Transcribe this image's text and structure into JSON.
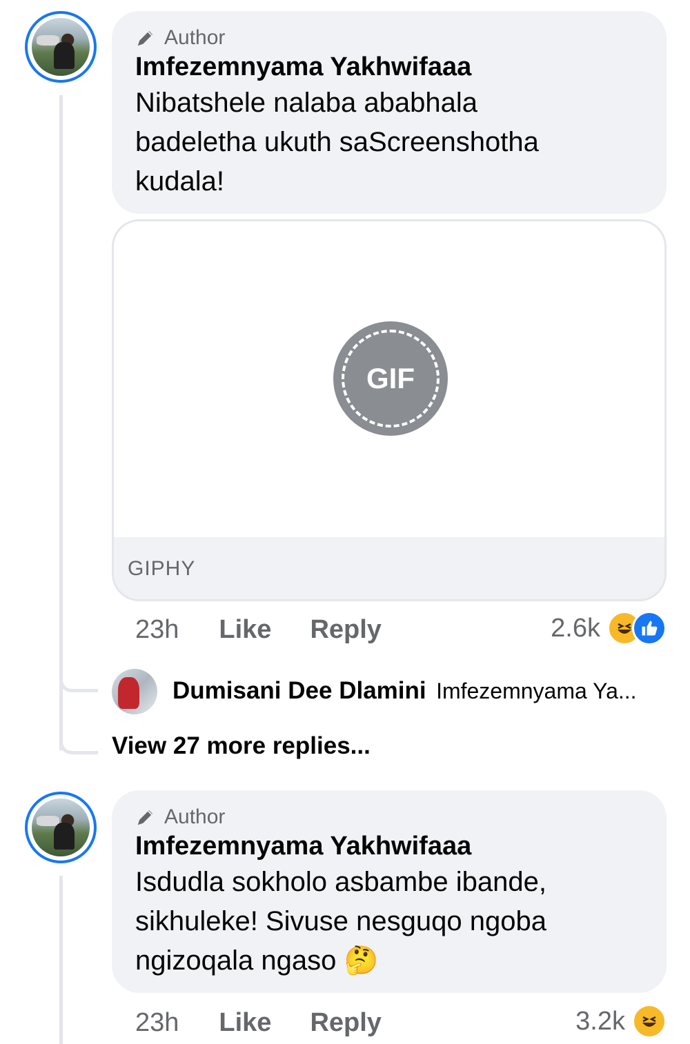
{
  "comments": [
    {
      "badge": "Author",
      "name": "Imfezemnyama Yakhwifaaa",
      "text_lines": [
        "Nibatshele nalaba ababhala",
        "badeletha ukuth saScreenshotha",
        "kudala!"
      ],
      "gif": {
        "label": "GIF",
        "provider": "GIPHY"
      },
      "time": "23h",
      "like_label": "Like",
      "reply_label": "Reply",
      "reaction_count": "2.6k",
      "reactions": [
        "haha-icon",
        "like-icon"
      ]
    },
    {
      "badge": "Author",
      "name": "Imfezemnyama Yakhwifaaa",
      "text_lines": [
        "Isdudla sokholo asbambe ibande,",
        "sikhuleke! Sivuse nesguqo ngoba",
        "ngizoqala ngaso"
      ],
      "emoji": "🤔",
      "time": "23h",
      "like_label": "Like",
      "reply_label": "Reply",
      "reaction_count": "3.2k",
      "reactions": [
        "haha-icon"
      ]
    }
  ],
  "reply_preview": {
    "name": "Dumisani Dee Dlamini",
    "snippet": "Imfezemnyama Ya..."
  },
  "view_more": "View 27 more replies...",
  "colors": {
    "accent": "#1877f2",
    "bubble": "#f0f2f5",
    "muted": "#65676b",
    "haha": "#f7b928"
  }
}
